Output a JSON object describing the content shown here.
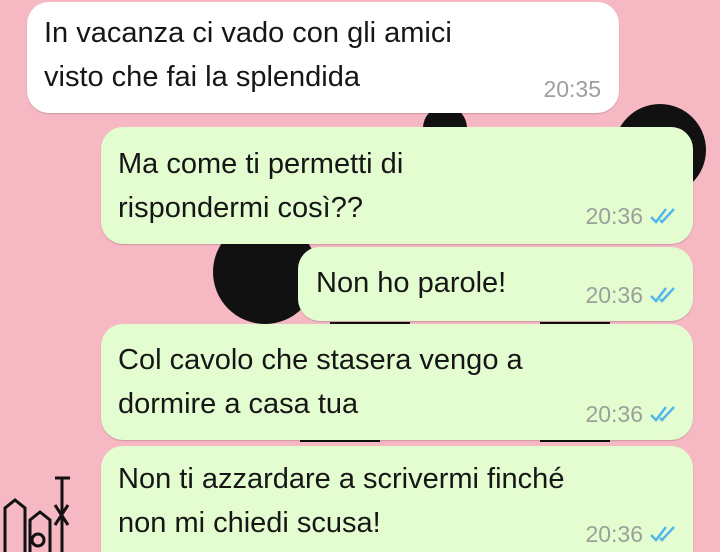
{
  "chat": {
    "messages": [
      {
        "direction": "incoming",
        "text": "In vacanza ci vado con gli amici\nvisto che fai la splendida",
        "time": "20:35"
      },
      {
        "direction": "outgoing",
        "text": "Ma come ti permetti di\nrispondermi così??",
        "time": "20:36",
        "status": "read-double-check-icon"
      },
      {
        "direction": "outgoing",
        "text": "Non ho parole!",
        "time": "20:36",
        "status": "read-double-check-icon"
      },
      {
        "direction": "outgoing",
        "text": "Col cavolo che stasera vengo a\ndormire a casa tua",
        "time": "20:36",
        "status": "read-double-check-icon"
      },
      {
        "direction": "outgoing",
        "text": "Non ti azzardare a scrivermi finché\nnon mi chiedi scusa!",
        "time": "20:36",
        "status": "read-double-check-icon"
      }
    ]
  },
  "colors": {
    "wallpaper": "#f6b8c3",
    "incoming_bubble": "#ffffff",
    "outgoing_bubble": "#e3fdd0",
    "read_ticks": "#4fb6ec",
    "timestamp": "#9aa09a"
  }
}
